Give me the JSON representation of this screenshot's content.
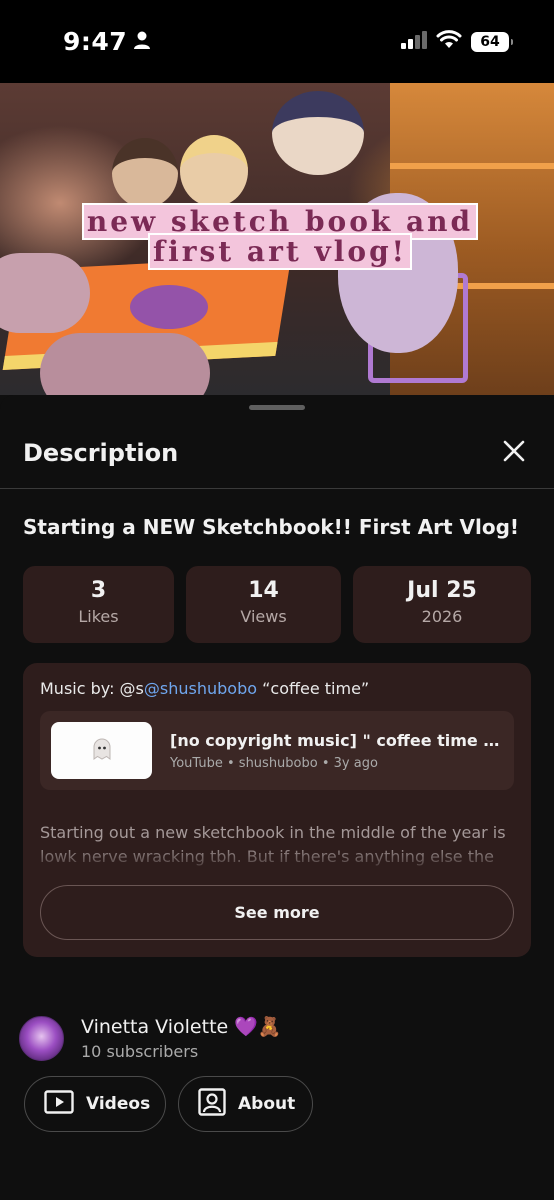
{
  "status_bar": {
    "time": "9:47",
    "battery": "64",
    "icons": [
      "person-icon",
      "cellular-signal-icon",
      "wifi-icon",
      "battery-icon"
    ]
  },
  "video": {
    "thumbnail_title_line1": "new sketch book and",
    "thumbnail_title_line2": "first art vlog!"
  },
  "sheet": {
    "title": "Description",
    "close_icon": "close-icon"
  },
  "details": {
    "video_title": "Starting a NEW Sketchbook!! First Art Vlog!",
    "stats": [
      {
        "value": "3",
        "label": "Likes"
      },
      {
        "value": "14",
        "label": "Views"
      },
      {
        "value": "Jul 25",
        "label": "2026"
      }
    ]
  },
  "description": {
    "music_prefix": "Music by: @s",
    "music_mention": "@shushubobo",
    "music_suffix": " “coffee time”",
    "music_item": {
      "title": "[no copyright music] \" coffee time \" cute background music",
      "meta": "YouTube • shushubobo • 3y ago"
    },
    "body": "Starting out a new sketchbook in the middle of the year is lowk nerve wracking tbh. But if there's anything else the wo",
    "see_more_label": "See more"
  },
  "channel": {
    "name": "Vinetta Violette 💜🧸",
    "subscribers": "10 subscribers",
    "buttons": {
      "videos_label": "Videos",
      "about_label": "About"
    }
  },
  "colors": {
    "background": "#0f0f0f",
    "card": "#2e1d1c",
    "mention": "#6fa6ee"
  }
}
